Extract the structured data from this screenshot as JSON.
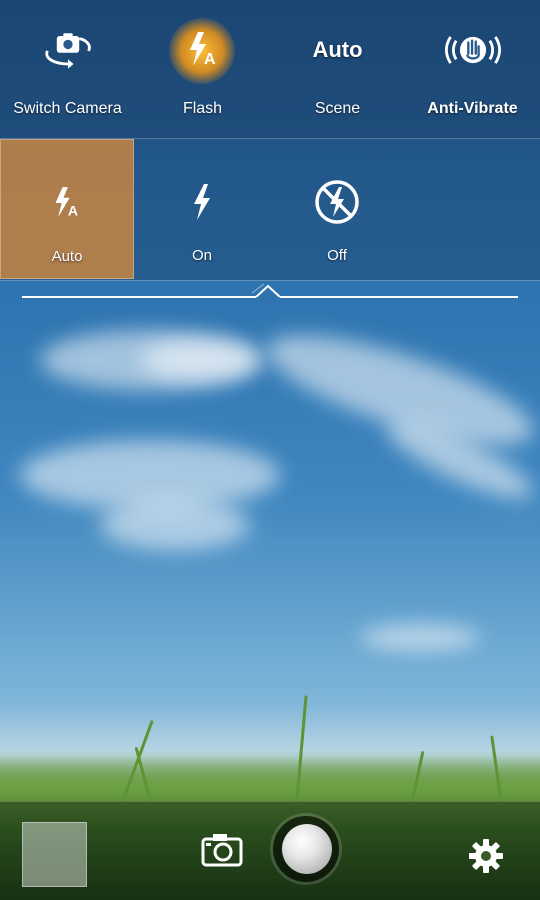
{
  "toolbar": {
    "switch_camera": "Switch Camera",
    "flash": "Flash",
    "scene_value": "Auto",
    "scene": "Scene",
    "anti_vibrate": "Anti-Vibrate"
  },
  "flash_options": {
    "auto": "Auto",
    "on": "On",
    "off": "Off",
    "selected": "Auto"
  },
  "colors": {
    "accent_selected": "#be8246",
    "flash_glow": "#f09614"
  },
  "icons": {
    "switch_camera": "switch-camera-icon",
    "flash": "flash-auto-icon",
    "anti_vibrate": "anti-vibrate-icon",
    "flash_auto": "flash-auto-icon",
    "flash_on": "flash-on-icon",
    "flash_off": "flash-off-icon",
    "mode": "camera-mode-icon",
    "settings": "gear-icon"
  }
}
